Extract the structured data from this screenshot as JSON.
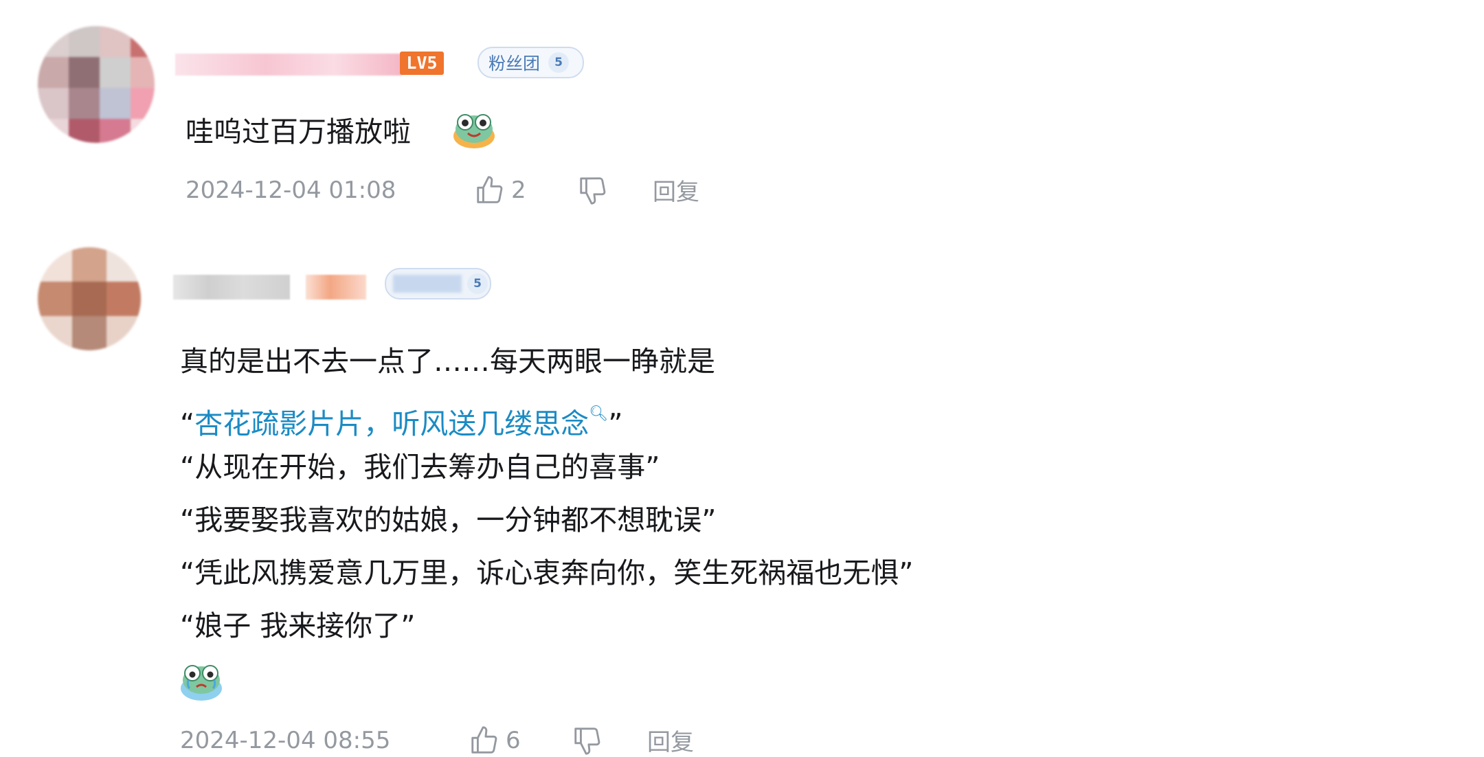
{
  "comments": [
    {
      "level_badge": "LV5",
      "fan_badge": {
        "label": "粉丝团",
        "level": "5"
      },
      "text": "哇呜过百万播放啦",
      "time": "2024-12-04 01:08",
      "likes": "2",
      "reply_label": "回复"
    },
    {
      "fan_badge": {
        "level": "5"
      },
      "lines": {
        "l1": "真的是出不去一点了……每天两眼一睁就是",
        "l2_open": "“",
        "l2_link": "杏花疏影片片，听风送几缕思念",
        "l2_close": "”",
        "l3": "“从现在开始，我们去筹办自己的喜事”",
        "l4": "“我要娶我喜欢的姑娘，一分钟都不想耽误”",
        "l5": "“凭此风携爱意几万里，诉心衷奔向你，笑生死祸福也无惧”",
        "l6": "“娘子 我来接你了”"
      },
      "time": "2024-12-04 08:55",
      "likes": "6",
      "reply_label": "回复"
    }
  ],
  "icons": [
    "thumbs-up-icon",
    "thumbs-down-icon",
    "search-icon"
  ],
  "colors": {
    "link": "#1b8bc4",
    "meta": "#9499a0",
    "level_badge": "#f0742c",
    "fan_badge_text": "#4a7ab6"
  }
}
